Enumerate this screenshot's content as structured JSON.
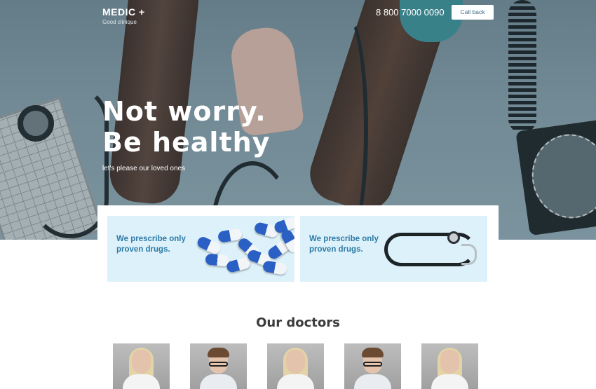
{
  "header": {
    "logo_title": "MEDIC +",
    "logo_subtitle": "Good clinique",
    "phone": "8 800 7000 0090",
    "call_back_label": "Call back"
  },
  "hero": {
    "headline_line1": "Not worry.",
    "headline_line2": "Be healthy",
    "tagline": "let's please our loved ones"
  },
  "features": [
    {
      "text": "We prescribe only proven drugs.",
      "image": "pills"
    },
    {
      "text": "We prescribe only proven drugs.",
      "image": "stethoscope"
    }
  ],
  "doctors": {
    "title": "Our doctors",
    "photos": [
      "doctor-female",
      "doctor-male-glasses",
      "doctor-female",
      "doctor-male-glasses",
      "doctor-female"
    ]
  },
  "colors": {
    "accent_text": "#2e7aa6",
    "card_background": "#ddf1fa",
    "hero_overlay": "#7e97a3"
  }
}
